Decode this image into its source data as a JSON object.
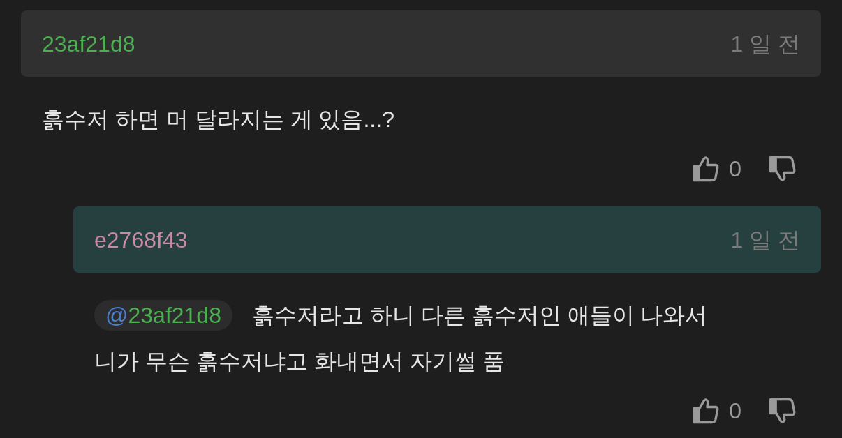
{
  "comments": [
    {
      "kind": "comment",
      "author": "23af21d8",
      "color": "#4caf50",
      "time": "1 일 전",
      "lines": [
        "흙수저 하면 머 달라지는 게 있음...?"
      ],
      "likes": "0"
    },
    {
      "kind": "reply",
      "author": "e2768f43",
      "color": "#c98aa6",
      "time": "1 일 전",
      "mention": {
        "at": "@",
        "user": "23af21d8"
      },
      "lines": [
        "흙수저라고 하니 다른 흙수저인 애들이 나와서",
        "니가 무슨 흙수저냐고 화내면서 자기썰 품"
      ],
      "likes": "0"
    }
  ]
}
